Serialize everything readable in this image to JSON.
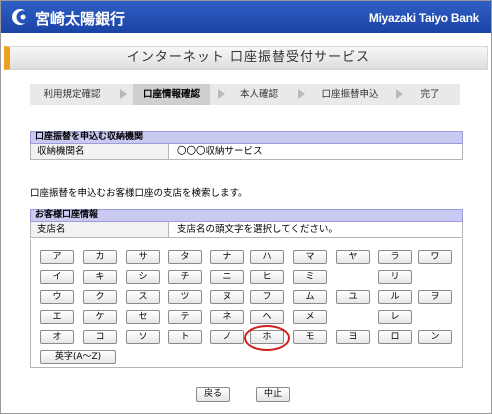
{
  "header": {
    "bank_name": "宮崎太陽銀行",
    "bank_name_en": "Miyazaki Taiyo Bank",
    "colors": {
      "header_bg": "#1b43a6",
      "accent": "#f0a020",
      "section_bg": "#c9caf1",
      "highlight": "#d0201d"
    },
    "logo_icon": "sun-crescent-logo"
  },
  "page_title": "インターネット 口座振替受付サービス",
  "steps": [
    {
      "label": "利用規定確認",
      "active": false
    },
    {
      "label": "口座情報確認",
      "active": true
    },
    {
      "label": "本人確認",
      "active": false
    },
    {
      "label": "口座振替申込",
      "active": false
    },
    {
      "label": "完了",
      "active": false
    }
  ],
  "institution_section": {
    "heading": "口座振替を申込む収納機関",
    "label": "収納機関名",
    "value": "〇〇〇収納サービス"
  },
  "instruction": "口座振替を申込むお客様口座の支店を検索します。",
  "account_section": {
    "heading": "お客様口座情報",
    "label": "支店名",
    "value": "支店名の頭文字を選択してください。"
  },
  "kana_rows": [
    [
      "ア",
      "カ",
      "サ",
      "タ",
      "ナ",
      "ハ",
      "マ",
      "ヤ",
      "ラ",
      "ワ"
    ],
    [
      "イ",
      "キ",
      "シ",
      "チ",
      "ニ",
      "ヒ",
      "ミ",
      "",
      "リ",
      ""
    ],
    [
      "ウ",
      "ク",
      "ス",
      "ツ",
      "ヌ",
      "フ",
      "ム",
      "ユ",
      "ル",
      "ヲ"
    ],
    [
      "エ",
      "ケ",
      "セ",
      "テ",
      "ネ",
      "ヘ",
      "メ",
      "",
      "レ",
      ""
    ],
    [
      "オ",
      "コ",
      "ソ",
      "ト",
      "ノ",
      "ホ",
      "モ",
      "ヨ",
      "ロ",
      "ン"
    ]
  ],
  "alpha_button": "英字(A～Z)",
  "highlighted_kana": "ホ",
  "footer": {
    "back": "戻る",
    "cancel": "中止"
  }
}
